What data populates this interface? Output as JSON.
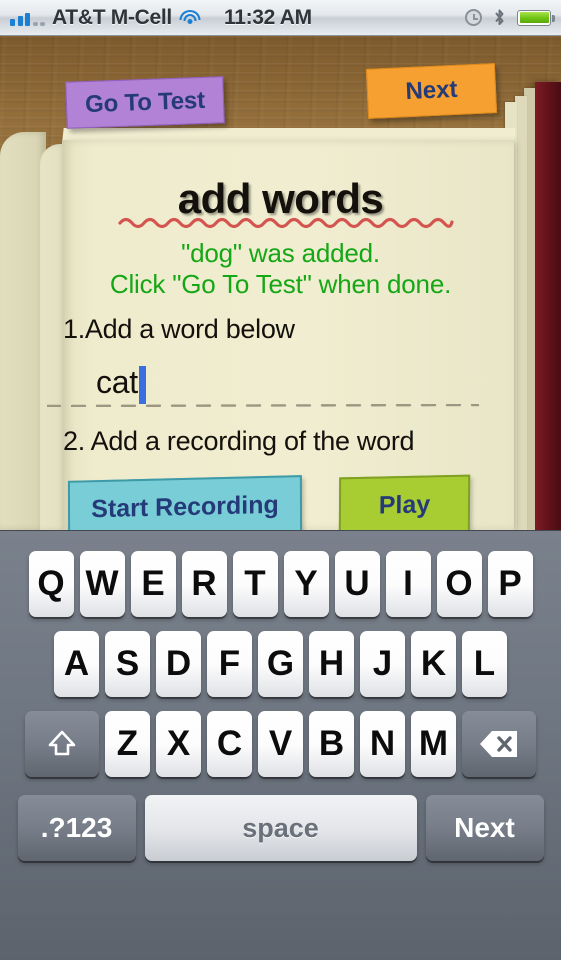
{
  "statusbar": {
    "carrier": "AT&T M-Cell",
    "time": "11:32 AM",
    "signal_icon": "signal-bars-icon",
    "wifi_icon": "wifi-icon",
    "alarm_icon": "alarm-clock-icon",
    "bluetooth_icon": "bluetooth-icon",
    "battery_icon": "battery-icon",
    "battery_color": "#6fc315"
  },
  "app": {
    "title": "add words",
    "top_buttons": {
      "go_to_test": "Go To Test",
      "next": "Next"
    },
    "messages": {
      "added": "\"dog\"  was added.",
      "instruction": "Click \"Go To Test\" when done."
    },
    "steps": {
      "step1": "1.Add a word below",
      "step2": "2. Add a recording of the word"
    },
    "word_input": {
      "value": "cat",
      "placeholder": ""
    },
    "action_buttons": {
      "record": "Start Recording",
      "play": "Play"
    },
    "colors": {
      "go_to_test": "#b182d6",
      "next": "#f5a030",
      "record": "#78cdd6",
      "play": "#a8cd33",
      "button_text": "#253a78",
      "green_text": "#16a716",
      "paper": "#f0edd0",
      "wood": "#8a6736",
      "cover": "#5e1118",
      "caret": "#3b6fe0"
    }
  },
  "keyboard": {
    "row1": [
      "Q",
      "W",
      "E",
      "R",
      "T",
      "Y",
      "U",
      "I",
      "O",
      "P"
    ],
    "row2": [
      "A",
      "S",
      "D",
      "F",
      "G",
      "H",
      "J",
      "K",
      "L"
    ],
    "row3": [
      "Z",
      "X",
      "C",
      "V",
      "B",
      "N",
      "M"
    ],
    "shift_icon": "shift-arrow-icon",
    "delete_icon": "backspace-delete-icon",
    "numeric_key": ".?123",
    "space_key": "space",
    "return_key": "Next"
  }
}
